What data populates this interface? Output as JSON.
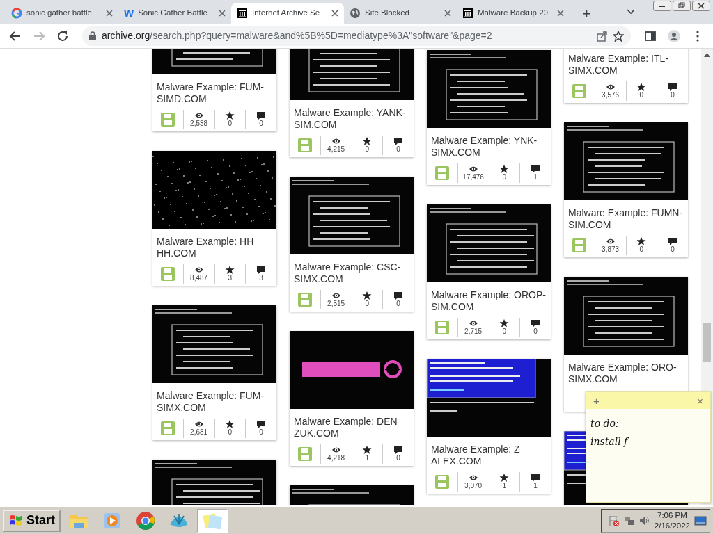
{
  "tabs": [
    {
      "kind": "google",
      "title": "sonic gather battle",
      "selected": false
    },
    {
      "kind": "letter",
      "favicon": "W",
      "title": "Sonic Gather Battle",
      "selected": false
    },
    {
      "kind": "archive",
      "title": "Internet Archive Se",
      "selected": true
    },
    {
      "kind": "globe",
      "title": "Site Blocked",
      "selected": false
    },
    {
      "kind": "archive",
      "title": "Malware Backup 20",
      "selected": false
    }
  ],
  "new_tab": "+",
  "address": {
    "host": "archive.org",
    "path": "/search.php?query=malware&and%5B%5D=mediatype%3A\"software\"&page=2"
  },
  "columns": [
    [
      {
        "kind": "card",
        "title": "Malware Example: FUM-SIMD.COM",
        "stats": {
          "views": "2,538",
          "favorites": "0",
          "reviews": "0"
        }
      },
      {
        "kind": "card",
        "title": "Malware Example: HH HH.COM",
        "stats": {
          "views": "8,487",
          "favorites": "3",
          "reviews": "3"
        }
      },
      {
        "kind": "card",
        "title": "Malware Example: FUM-SIMX.COM",
        "stats": {
          "views": "2,681",
          "favorites": "0",
          "reviews": "0"
        }
      },
      {
        "kind": "picture"
      }
    ],
    [
      {
        "kind": "card",
        "title": "Malware Example: YANK-SIM.COM",
        "stats": {
          "views": "4,215",
          "favorites": "0",
          "reviews": "0"
        }
      },
      {
        "kind": "card",
        "title": "Malware Example: CSC-SIMX.COM",
        "stats": {
          "views": "2,515",
          "favorites": "0",
          "reviews": "0"
        }
      },
      {
        "kind": "card",
        "title": "Malware Example: DEN ZUK.COM",
        "stats": {
          "views": "4,218",
          "favorites": "1",
          "reviews": "0"
        }
      },
      {
        "kind": "picture"
      }
    ],
    [
      {
        "kind": "card",
        "title": "Malware Example: YNK-SIMX.COM",
        "stats": {
          "views": "17,476",
          "favorites": "0",
          "reviews": "1"
        }
      },
      {
        "kind": "card",
        "title": "Malware Example: OROP-SIM.COM",
        "stats": {
          "views": "2,715",
          "favorites": "0",
          "reviews": "0"
        }
      },
      {
        "kind": "card",
        "title": "Malware Example: Z ALEX.COM",
        "stats": {
          "views": "3,070",
          "favorites": "1",
          "reviews": "1"
        }
      }
    ],
    [
      {
        "kind": "card",
        "title": "Malware Example: ITL-SIMX.COM",
        "stats": {
          "views": "3,576",
          "favorites": "0",
          "reviews": "0"
        }
      },
      {
        "kind": "card",
        "title": "Malware Example: FUMN-SIM.COM",
        "stats": {
          "views": "3,873",
          "favorites": "0",
          "reviews": "0"
        }
      },
      {
        "kind": "card",
        "title": "Malware Example: ORO-SIMX.COM"
      },
      {
        "kind": "picture"
      }
    ]
  ],
  "sticky_note": {
    "add": "+",
    "close": "×",
    "lines": [
      "to do:",
      "install f"
    ]
  },
  "taskbar": {
    "start": "Start",
    "time": "7:06 PM",
    "date": "2/16/2022"
  }
}
